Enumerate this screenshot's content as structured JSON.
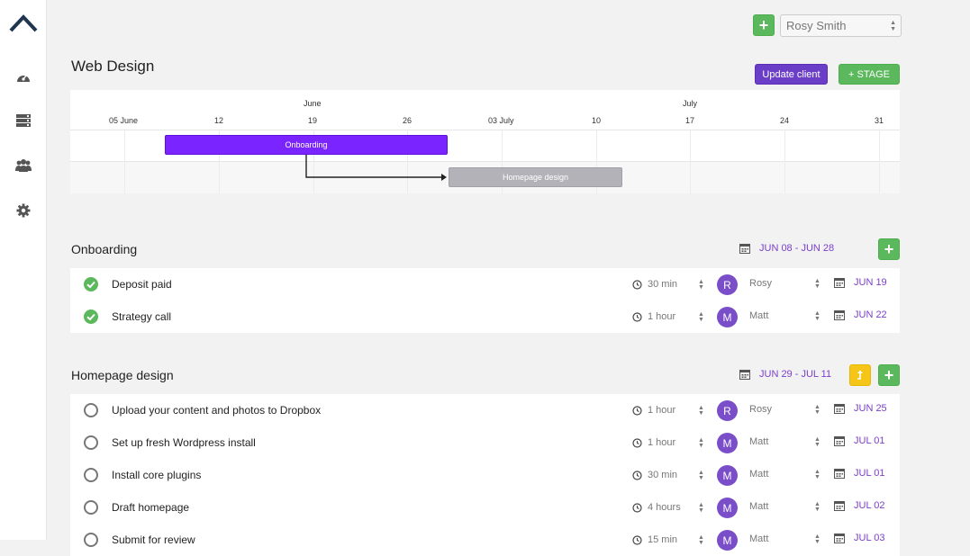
{
  "header": {
    "client": "Rosy Smith",
    "add_label": "+"
  },
  "page": {
    "title": "Web Design",
    "update_client_label": "Update client",
    "add_stage_label": "+ STAGE"
  },
  "gantt": {
    "months": [
      "June",
      "July"
    ],
    "days": [
      "05 June",
      "12",
      "19",
      "26",
      "03 July",
      "10",
      "17",
      "24",
      "31"
    ],
    "bars": [
      {
        "label": "Onboarding",
        "color": "#7a24ff"
      },
      {
        "label": "Homepage design",
        "color": "#b3b2b8"
      }
    ]
  },
  "sections": [
    {
      "title": "Onboarding",
      "date_range": "JUN 08 - JUN 28",
      "tasks": [
        {
          "name": "Deposit paid",
          "done": true,
          "duration": "30 min",
          "initial": "R",
          "assignee": "Rosy",
          "date": "JUN 19"
        },
        {
          "name": "Strategy call",
          "done": true,
          "duration": "1 hour",
          "initial": "M",
          "assignee": "Matt",
          "date": "JUN 22"
        }
      ]
    },
    {
      "title": "Homepage design",
      "date_range": "JUN 29 - JUL 11",
      "tasks": [
        {
          "name": "Upload your content and photos to Dropbox",
          "done": false,
          "duration": "1 hour",
          "initial": "R",
          "assignee": "Rosy",
          "date": "JUN 25"
        },
        {
          "name": "Set up fresh Wordpress install",
          "done": false,
          "duration": "1 hour",
          "initial": "M",
          "assignee": "Matt",
          "date": "JUL 01"
        },
        {
          "name": "Install core plugins",
          "done": false,
          "duration": "30 min",
          "initial": "M",
          "assignee": "Matt",
          "date": "JUL 01"
        },
        {
          "name": "Draft homepage",
          "done": false,
          "duration": "4 hours",
          "initial": "M",
          "assignee": "Matt",
          "date": "JUL 02"
        },
        {
          "name": "Submit for review",
          "done": false,
          "duration": "15 min",
          "initial": "M",
          "assignee": "Matt",
          "date": "JUL 03"
        }
      ]
    }
  ],
  "colors": {
    "accent": "#7a3fc9",
    "green": "#5cb85c",
    "yellow": "#f5c518",
    "purple_button": "#6a3ec7"
  },
  "icons": {
    "sidebar": [
      "dashboard-icon",
      "server-icon",
      "users-icon",
      "gear-icon"
    ]
  }
}
